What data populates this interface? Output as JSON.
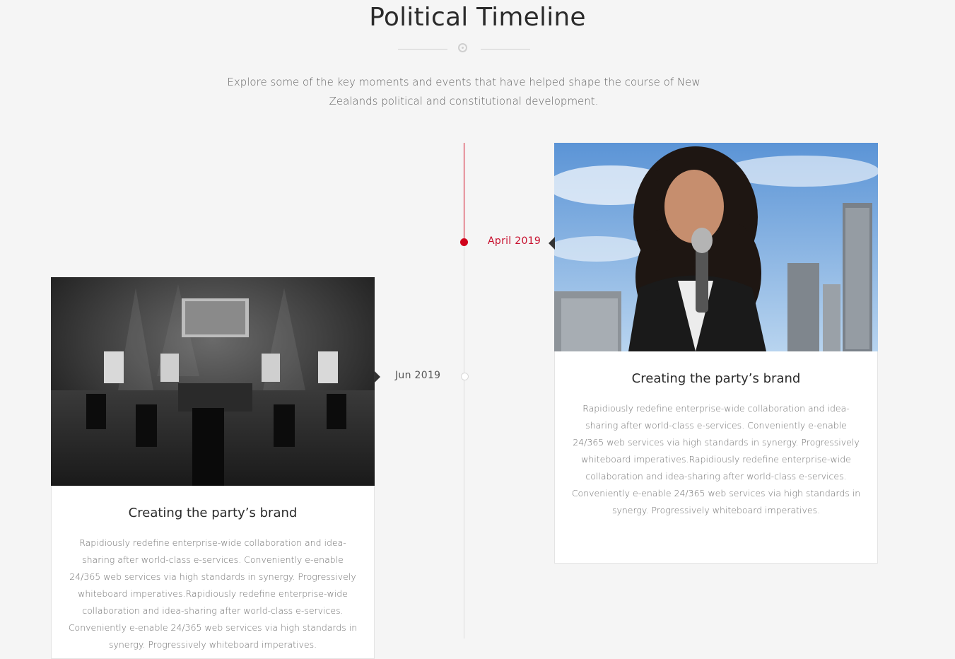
{
  "header": {
    "title": "Political Timeline",
    "intro": "Explore some of the key moments and events that have helped shape the course of New Zealands political and constitutional development."
  },
  "timeline": {
    "accent_color": "#d0021b",
    "events": [
      {
        "date": "April 2019",
        "active": true,
        "title": "Creating the party’s brand",
        "body": "Rapidiously redefine enterprise-wide collaboration and idea-sharing after world-class e-services. Conveniently e-enable 24/365 web services via high standards in synergy. Progressively whiteboard imperatives.Rapidiously redefine enterprise-wide collaboration and idea-sharing after world-class e-services. Conveniently e-enable 24/365 web services via high standards in synergy. Progressively whiteboard imperatives.",
        "image": "woman-speaking-microphone-photo"
      },
      {
        "date": "Jun 2019",
        "active": false,
        "title": "Creating the party’s brand",
        "body": "Rapidiously redefine enterprise-wide collaboration and idea-sharing after world-class e-services. Conveniently e-enable 24/365 web services via high standards in synergy. Progressively whiteboard imperatives.Rapidiously redefine enterprise-wide collaboration and idea-sharing after world-class e-services. Conveniently e-enable 24/365 web services via high standards in synergy. Progressively whiteboard imperatives.",
        "image": "event-hall-photo"
      }
    ]
  }
}
